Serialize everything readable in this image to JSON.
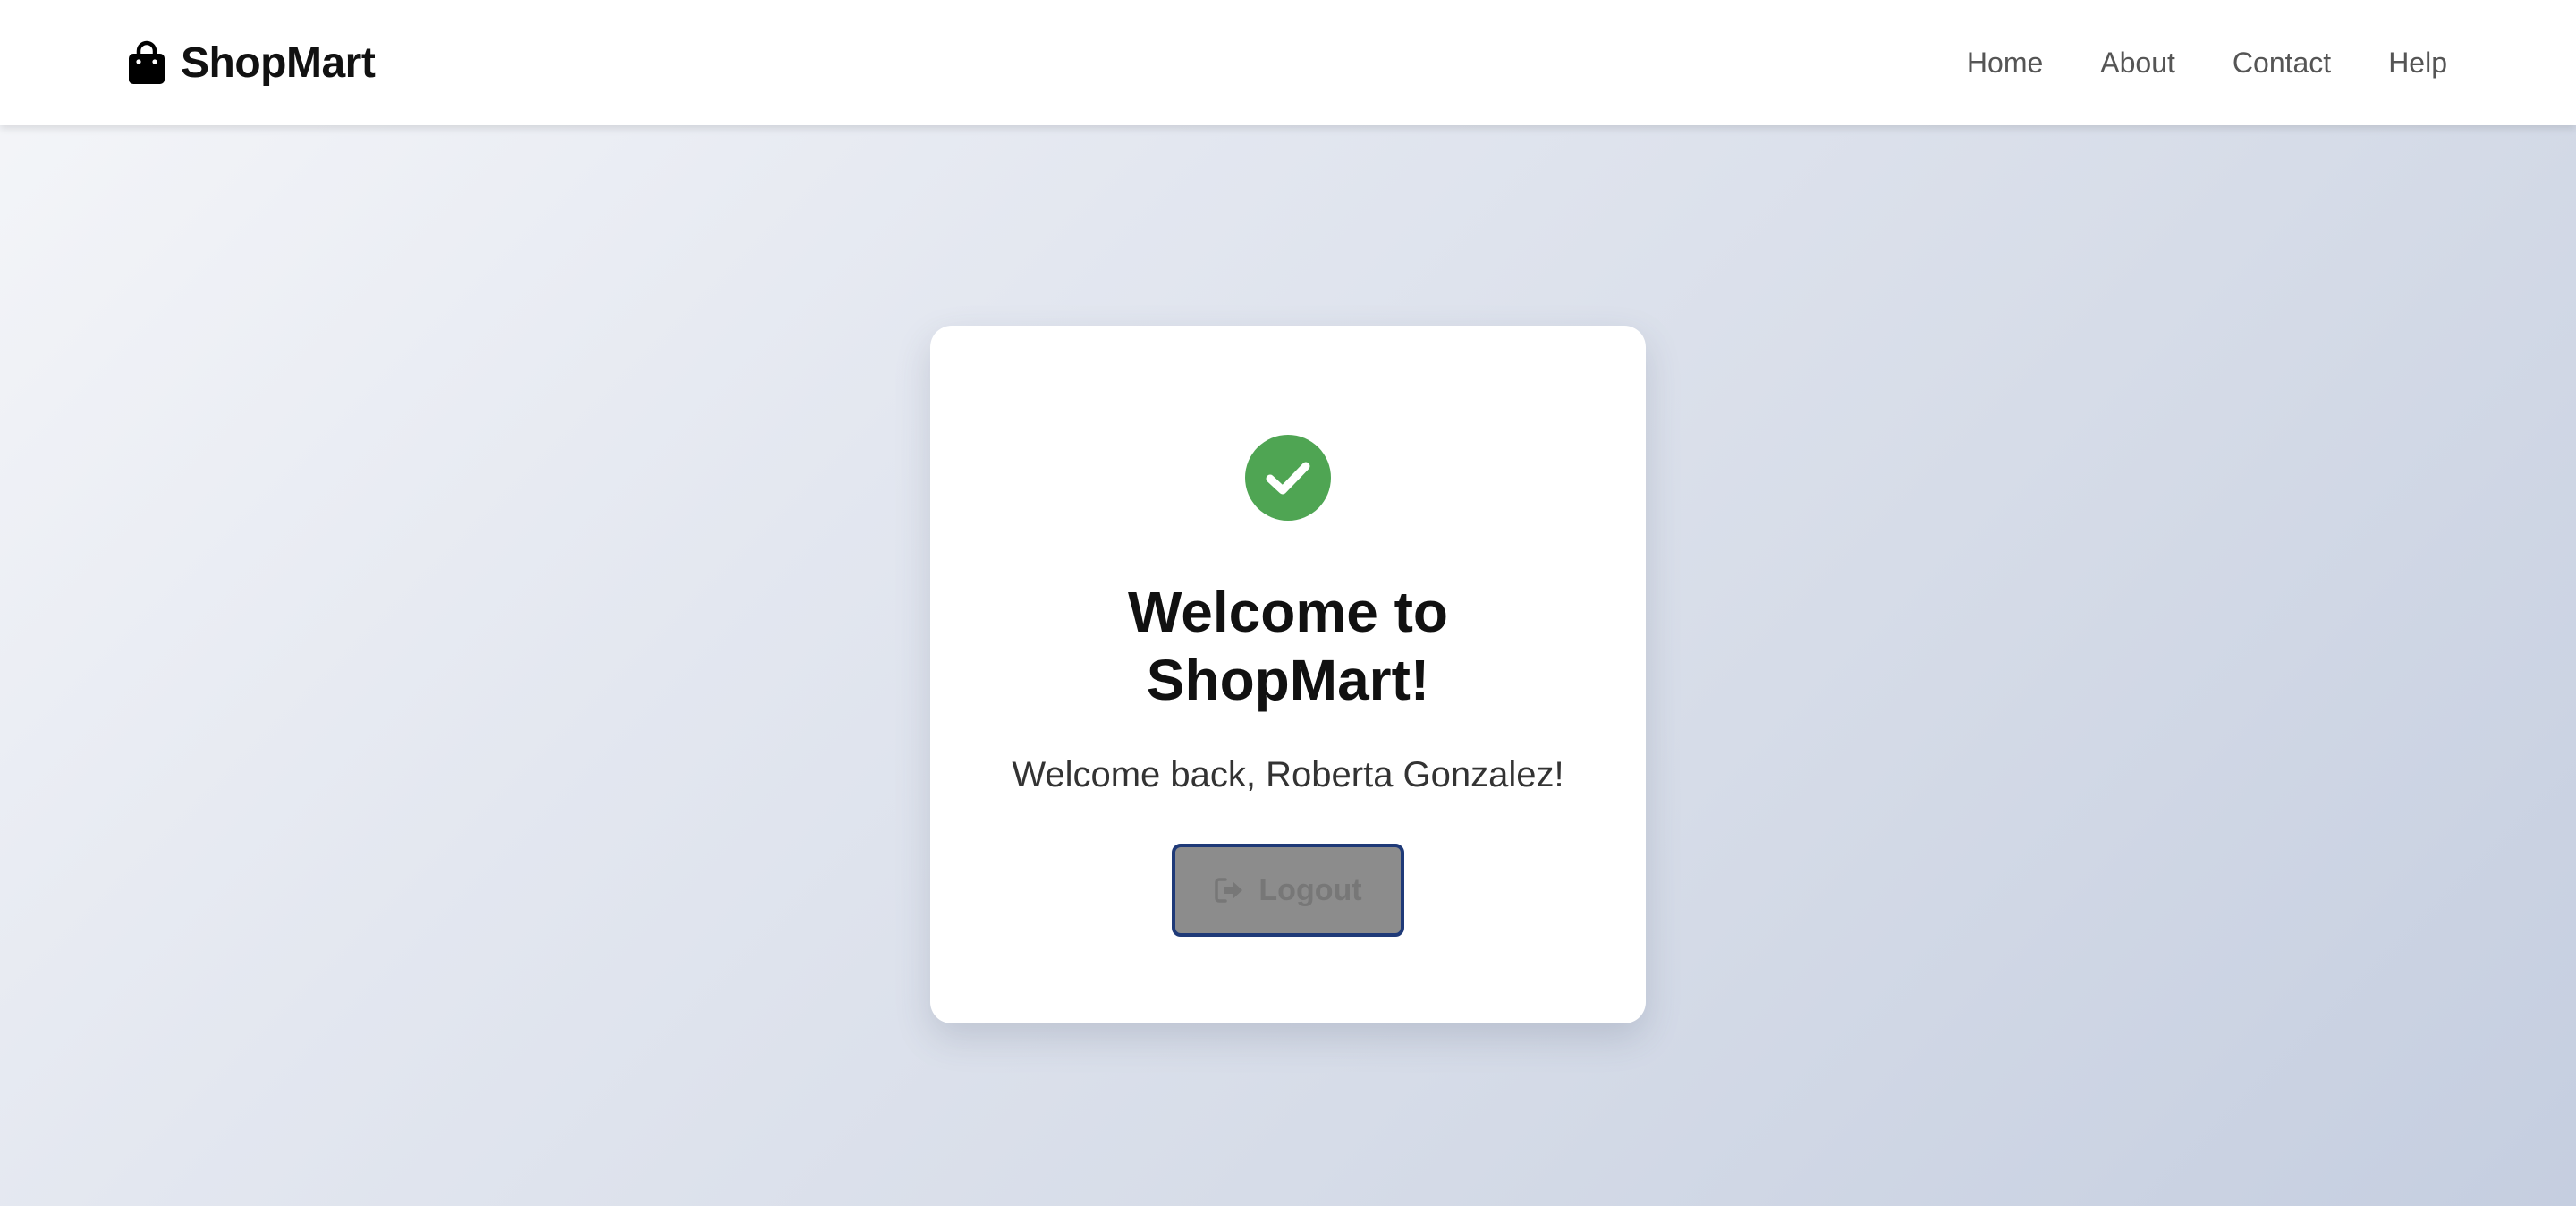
{
  "header": {
    "brand_name": "ShopMart",
    "brand_icon": "shopping-bag-icon",
    "nav": [
      {
        "label": "Home"
      },
      {
        "label": "About"
      },
      {
        "label": "Contact"
      },
      {
        "label": "Help"
      }
    ]
  },
  "card": {
    "status_icon": "check-circle-icon",
    "title": "Welcome to ShopMart!",
    "welcome_message": "Welcome back, Roberta Gonzalez!",
    "logout_label": "Logout",
    "logout_icon": "sign-out-icon"
  },
  "colors": {
    "success": "#4fa553",
    "button_bg": "#8c8c8c",
    "button_border": "#1f3a78",
    "nav_text": "#555555"
  }
}
